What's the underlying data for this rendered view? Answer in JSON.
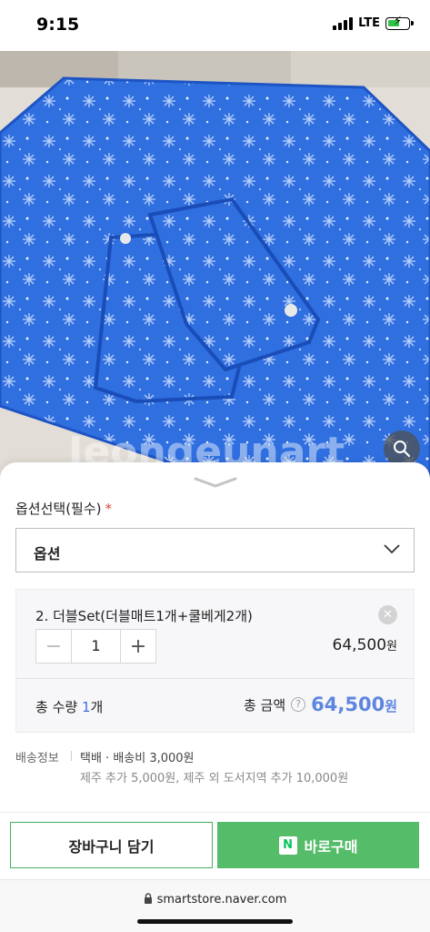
{
  "status": {
    "time": "9:15",
    "network": "LTE",
    "battery_color": "#36c24a"
  },
  "product_image": {
    "watermark": "Jeongeunart",
    "zoom_icon": "search-icon"
  },
  "option": {
    "title": "옵션선택(필수)",
    "required_mark": "*",
    "select_label": "옵션"
  },
  "selected_item": {
    "name": "2. 더블Set(더블매트1개+쿨베게2개)",
    "remove_icon": "close-icon",
    "quantity": "1",
    "price": "64,500",
    "currency": "원"
  },
  "total": {
    "qty_label": "총 수량",
    "qty_value": "1",
    "qty_unit": "개",
    "amount_label": "총 금액",
    "help_mark": "?",
    "amount": "64,500",
    "currency": "원",
    "accent_color": "#5e86e0"
  },
  "shipping": {
    "label": "배송정보",
    "main": "택배 · 배송비 3,000원",
    "extra": "제주 추가 5,000원, 제주 외 도서지역 추가 10,000원"
  },
  "actions": {
    "cart_label": "장바구니 담기",
    "buy_label": "바로구매",
    "npay_mark": "N",
    "buy_color": "#55bc6a"
  },
  "browser": {
    "url": "smartstore.naver.com"
  }
}
